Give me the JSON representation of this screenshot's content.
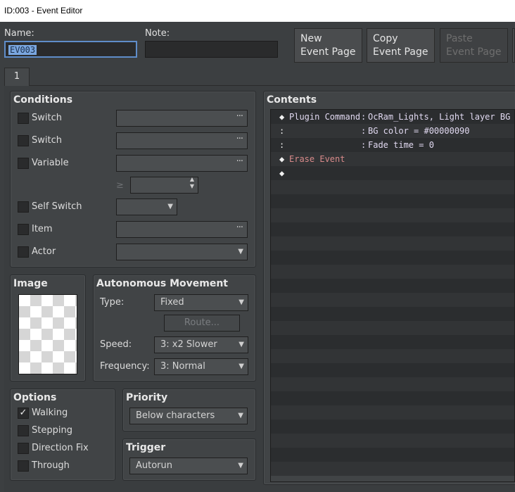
{
  "window": {
    "title": "ID:003 - Event Editor"
  },
  "header": {
    "name_label": "Name:",
    "name_value": "EV003",
    "note_label": "Note:",
    "note_value": "",
    "new_page_l1": "New",
    "new_page_l2": "Event Page",
    "copy_page_l1": "Copy",
    "copy_page_l2": "Event Page",
    "paste_page_l1": "Paste",
    "paste_page_l2": "Event Page"
  },
  "tabs": [
    {
      "label": "1"
    }
  ],
  "conditions": {
    "title": "Conditions",
    "switch1_label": "Switch",
    "switch2_label": "Switch",
    "variable_label": "Variable",
    "gte_symbol": "≥",
    "self_switch_label": "Self Switch",
    "item_label": "Item",
    "actor_label": "Actor",
    "ellipsis": "···"
  },
  "image": {
    "title": "Image"
  },
  "movement": {
    "title": "Autonomous Movement",
    "type_label": "Type:",
    "type_value": "Fixed",
    "route_button": "Route...",
    "speed_label": "Speed:",
    "speed_value": "3: x2 Slower",
    "frequency_label": "Frequency:",
    "frequency_value": "3: Normal"
  },
  "options": {
    "title": "Options",
    "walking": "Walking",
    "walking_checked": true,
    "stepping": "Stepping",
    "direction_fix": "Direction Fix",
    "through": "Through",
    "check_mark": "✓"
  },
  "priority": {
    "title": "Priority",
    "value": "Below characters"
  },
  "trigger": {
    "title": "Trigger",
    "value": "Autorun"
  },
  "contents": {
    "title": "Contents",
    "lines": [
      {
        "prefix": "◆",
        "label": "Plugin Command",
        "sep": ":",
        "text": "OcRam_Lights, Light layer BG"
      },
      {
        "prefix": ":",
        "label": "",
        "sep": ":",
        "text": "BG color = #00000090"
      },
      {
        "prefix": ":",
        "label": "",
        "sep": ":",
        "text": "Fade time = 0"
      },
      {
        "prefix": "◆",
        "label": "Erase Event",
        "sep": "",
        "text": ""
      },
      {
        "prefix": "◆",
        "label": "",
        "sep": "",
        "text": ""
      }
    ]
  },
  "icons": {
    "dropdown": "▼",
    "spin_up": "▲",
    "spin_down": "▼"
  }
}
